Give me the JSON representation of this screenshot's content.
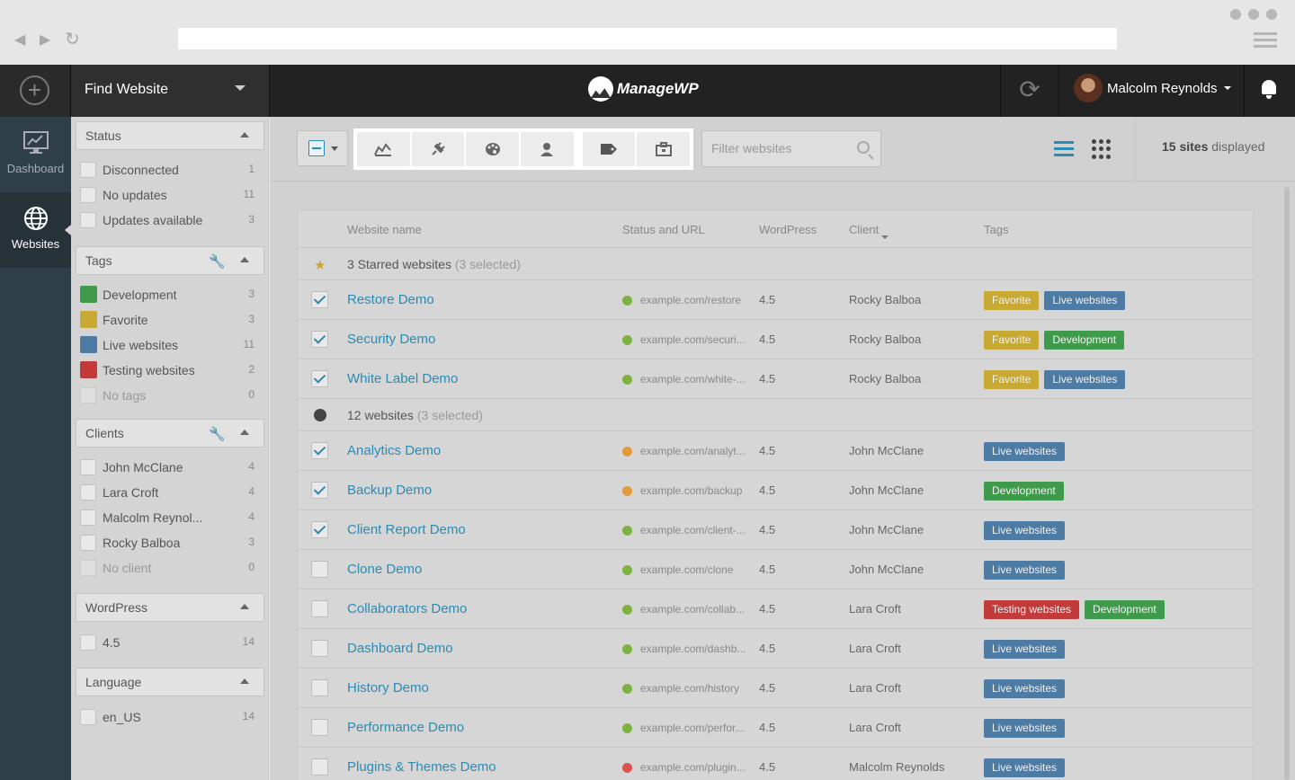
{
  "app": {
    "find_label": "Find Website",
    "logo_text": "ManageWP",
    "user_name": "Malcolm Reynolds"
  },
  "rail": [
    {
      "label": "Dashboard"
    },
    {
      "label": "Websites"
    }
  ],
  "filters": {
    "status": {
      "title": "Status",
      "items": [
        {
          "label": "Disconnected",
          "count": "1"
        },
        {
          "label": "No updates",
          "count": "11"
        },
        {
          "label": "Updates available",
          "count": "3"
        }
      ]
    },
    "tags": {
      "title": "Tags",
      "items": [
        {
          "label": "Development",
          "count": "3",
          "color": "#3f9b4b"
        },
        {
          "label": "Favorite",
          "count": "3",
          "color": "#c7a933"
        },
        {
          "label": "Live websites",
          "count": "11",
          "color": "#4d7ba3"
        },
        {
          "label": "Testing websites",
          "count": "2",
          "color": "#c23a3a"
        },
        {
          "label": "No tags",
          "count": "0"
        }
      ]
    },
    "clients": {
      "title": "Clients",
      "items": [
        {
          "label": "John McClane",
          "count": "4"
        },
        {
          "label": "Lara Croft",
          "count": "4"
        },
        {
          "label": "Malcolm Reynol...",
          "count": "4"
        },
        {
          "label": "Rocky Balboa",
          "count": "3"
        },
        {
          "label": "No client",
          "count": "0"
        }
      ]
    },
    "wordpress": {
      "title": "WordPress",
      "items": [
        {
          "label": "4.5",
          "count": "14"
        }
      ]
    },
    "language": {
      "title": "Language",
      "items": [
        {
          "label": "en_US",
          "count": "14"
        }
      ]
    }
  },
  "toolbar": {
    "filter_placeholder": "Filter websites",
    "count_number": "15 sites",
    "count_suffix": " displayed"
  },
  "table": {
    "headers": {
      "name": "Website name",
      "status": "Status and URL",
      "wordpress": "WordPress",
      "client": "Client",
      "tags": "Tags"
    },
    "groups": [
      {
        "bold": "3 Starred websites",
        "selected": " (3 selected)"
      },
      {
        "bold": "12 websites",
        "selected": " (3 selected)"
      }
    ],
    "rows": [
      {
        "name": "Restore Demo",
        "url": "example.com/restore",
        "wp": "4.5",
        "client": "Rocky Balboa",
        "checked": true,
        "status": "#7cb342",
        "tags": [
          {
            "label": "Favorite",
            "cls": "t-fav"
          },
          {
            "label": "Live websites",
            "cls": "t-live"
          }
        ]
      },
      {
        "name": "Security Demo",
        "url": "example.com/securi...",
        "wp": "4.5",
        "client": "Rocky Balboa",
        "checked": true,
        "status": "#7cb342",
        "tags": [
          {
            "label": "Favorite",
            "cls": "t-fav"
          },
          {
            "label": "Development",
            "cls": "t-dev"
          }
        ]
      },
      {
        "name": "White Label Demo",
        "url": "example.com/white-...",
        "wp": "4.5",
        "client": "Rocky Balboa",
        "checked": true,
        "status": "#7cb342",
        "tags": [
          {
            "label": "Favorite",
            "cls": "t-fav"
          },
          {
            "label": "Live websites",
            "cls": "t-live"
          }
        ]
      },
      {
        "name": "Analytics Demo",
        "url": "example.com/analyt...",
        "wp": "4.5",
        "client": "John McClane",
        "checked": true,
        "status": "#e59a3c",
        "tags": [
          {
            "label": "Live websites",
            "cls": "t-live"
          }
        ]
      },
      {
        "name": "Backup Demo",
        "url": "example.com/backup",
        "wp": "4.5",
        "client": "John McClane",
        "checked": true,
        "status": "#e59a3c",
        "tags": [
          {
            "label": "Development",
            "cls": "t-dev"
          }
        ]
      },
      {
        "name": "Client Report Demo",
        "url": "example.com/client-...",
        "wp": "4.5",
        "client": "John McClane",
        "checked": true,
        "status": "#7cb342",
        "tags": [
          {
            "label": "Live websites",
            "cls": "t-live"
          }
        ]
      },
      {
        "name": "Clone Demo",
        "url": "example.com/clone",
        "wp": "4.5",
        "client": "John McClane",
        "checked": false,
        "status": "#7cb342",
        "tags": [
          {
            "label": "Live websites",
            "cls": "t-live"
          }
        ]
      },
      {
        "name": "Collaborators Demo",
        "url": "example.com/collab...",
        "wp": "4.5",
        "client": "Lara Croft",
        "checked": false,
        "status": "#7cb342",
        "tags": [
          {
            "label": "Testing websites",
            "cls": "t-test"
          },
          {
            "label": "Development",
            "cls": "t-dev"
          }
        ]
      },
      {
        "name": "Dashboard Demo",
        "url": "example.com/dashb...",
        "wp": "4.5",
        "client": "Lara Croft",
        "checked": false,
        "status": "#7cb342",
        "tags": [
          {
            "label": "Live websites",
            "cls": "t-live"
          }
        ]
      },
      {
        "name": "History Demo",
        "url": "example.com/history",
        "wp": "4.5",
        "client": "Lara Croft",
        "checked": false,
        "status": "#7cb342",
        "tags": [
          {
            "label": "Live websites",
            "cls": "t-live"
          }
        ]
      },
      {
        "name": "Performance Demo",
        "url": "example.com/perfor...",
        "wp": "4.5",
        "client": "Lara Croft",
        "checked": false,
        "status": "#7cb342",
        "tags": [
          {
            "label": "Live websites",
            "cls": "t-live"
          }
        ]
      },
      {
        "name": "Plugins & Themes Demo",
        "url": "example.com/plugin...",
        "wp": "4.5",
        "client": "Malcolm Reynolds",
        "checked": false,
        "status": "#d9534f",
        "tags": [
          {
            "label": "Live websites",
            "cls": "t-live"
          }
        ]
      }
    ]
  },
  "icons": [
    "back-icon",
    "forward-icon",
    "reload-icon",
    "plus-icon",
    "chevron-down-icon",
    "sync-icon",
    "bell-icon",
    "dashboard-icon",
    "globe-icon",
    "wrench-icon",
    "chart-icon",
    "plugin-icon",
    "palette-icon",
    "client-icon",
    "tag-icon",
    "briefcase-icon",
    "search-icon",
    "list-view-icon",
    "grid-view-icon",
    "star-icon"
  ]
}
